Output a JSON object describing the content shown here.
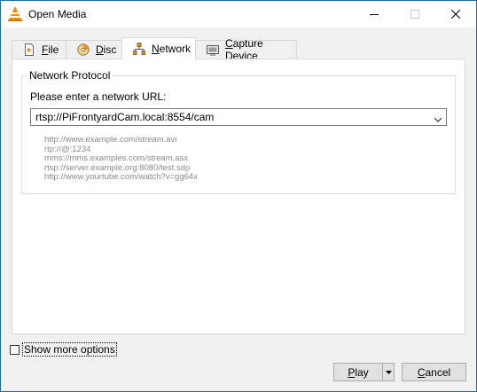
{
  "window": {
    "title": "Open Media",
    "controls": {
      "minimize_icon": "minimize-icon",
      "maximize_icon": "maximize-icon",
      "close_icon": "close-icon"
    }
  },
  "tabs": [
    {
      "label_pre": "",
      "label_ul": "F",
      "label_post": "ile",
      "icon": "file-icon",
      "active": false
    },
    {
      "label_pre": "",
      "label_ul": "D",
      "label_post": "isc",
      "icon": "disc-icon",
      "active": false
    },
    {
      "label_pre": "",
      "label_ul": "N",
      "label_post": "etwork",
      "icon": "network-icon",
      "active": true
    },
    {
      "label_pre": "",
      "label_ul": "C",
      "label_post": "apture Device",
      "icon": "capture-device-icon",
      "active": false
    }
  ],
  "network": {
    "group_title": "Network Protocol",
    "prompt": "Please enter a network URL:",
    "url_value": "rtsp://PiFrontyardCam.local:8554/cam",
    "examples": [
      "http://www.example.com/stream.avi",
      "rtp://@:1234",
      "mms://mms.examples.com/stream.asx",
      "rtsp://server.example.org:8080/test.sdp",
      "http://www.yourtube.com/watch?v=gg64x"
    ]
  },
  "footer": {
    "show_more_options": "Show more options",
    "show_more_checked": false,
    "play_label_ul": "P",
    "play_label_post": "lay",
    "cancel_label_ul": "C",
    "cancel_label_post": "ancel"
  },
  "colors": {
    "window_border": "#1c6ca8",
    "dialog_bg": "#f0f0f0",
    "panel_bg": "#ffffff",
    "example_text": "#8a8a8a",
    "button_bg": "#e1e1e1",
    "vlc_orange": "#f48b00"
  }
}
